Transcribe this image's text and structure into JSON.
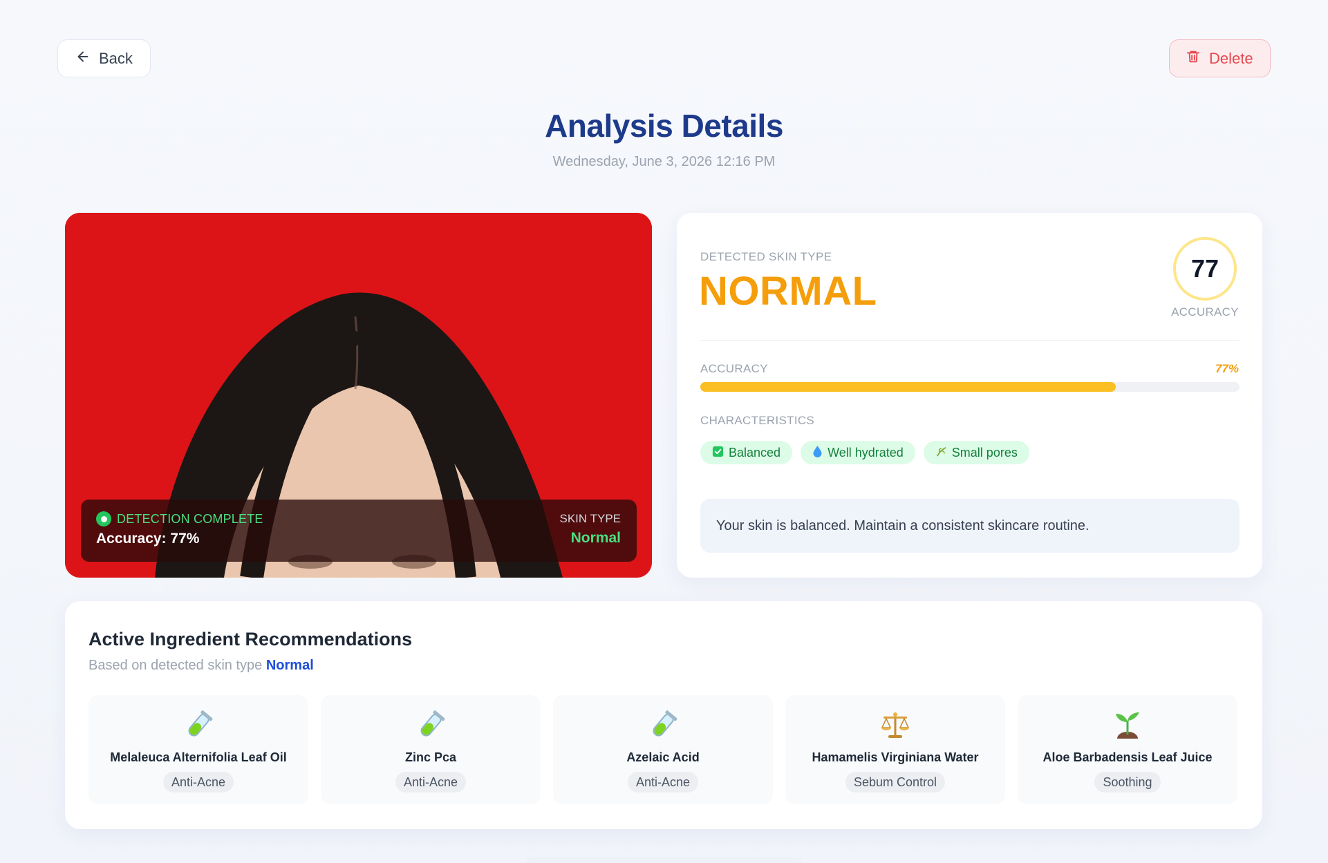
{
  "topbar": {
    "back_label": "Back",
    "back_icon": "arrow-left-icon",
    "delete_label": "Delete",
    "delete_icon": "trash-icon"
  },
  "header": {
    "title": "Analysis Details",
    "date": "Wednesday, June 3, 2026 12:16 PM"
  },
  "photo": {
    "status": "DETECTION COMPLETE",
    "accuracy_text": "Accuracy: 77%",
    "skin_type_label": "SKIN TYPE",
    "skin_type_value": "Normal",
    "background_color": "#dd1417"
  },
  "result": {
    "detected_label": "DETECTED SKIN TYPE",
    "detected_value": "NORMAL",
    "score": "77",
    "score_label": "ACCURACY",
    "accuracy_label": "ACCURACY",
    "accuracy_value": "77%",
    "accuracy_fraction": 0.77,
    "characteristics_label": "CHARACTERISTICS",
    "characteristics": [
      {
        "label": "Balanced",
        "icon": "check-icon"
      },
      {
        "label": "Well hydrated",
        "icon": "droplet-icon"
      },
      {
        "label": "Small pores",
        "icon": "leaf-icon"
      }
    ],
    "advice": "Your skin is balanced. Maintain a consistent skincare routine."
  },
  "ingredients": {
    "title": "Active Ingredient Recommendations",
    "subtitle_prefix": "Based on detected skin type ",
    "subtitle_highlight": "Normal",
    "items": [
      {
        "name": "Melaleuca Alternifolia Leaf Oil",
        "category": "Anti-Acne",
        "icon": "test-tube-icon"
      },
      {
        "name": "Zinc Pca",
        "category": "Anti-Acne",
        "icon": "test-tube-icon"
      },
      {
        "name": "Azelaic Acid",
        "category": "Anti-Acne",
        "icon": "test-tube-icon"
      },
      {
        "name": "Hamamelis Virginiana Water",
        "category": "Sebum Control",
        "icon": "balance-scale-icon"
      },
      {
        "name": "Aloe Barbadensis Leaf Juice",
        "category": "Soothing",
        "icon": "seedling-icon"
      }
    ]
  },
  "colors": {
    "title": "#1e3a8a",
    "skin_type_accent": "#f59e0b",
    "progress": "#fbbf24",
    "tag_bg": "#dcfce7",
    "tag_text": "#15803d",
    "delete": "#e5484d",
    "highlight": "#1d4ed8"
  }
}
